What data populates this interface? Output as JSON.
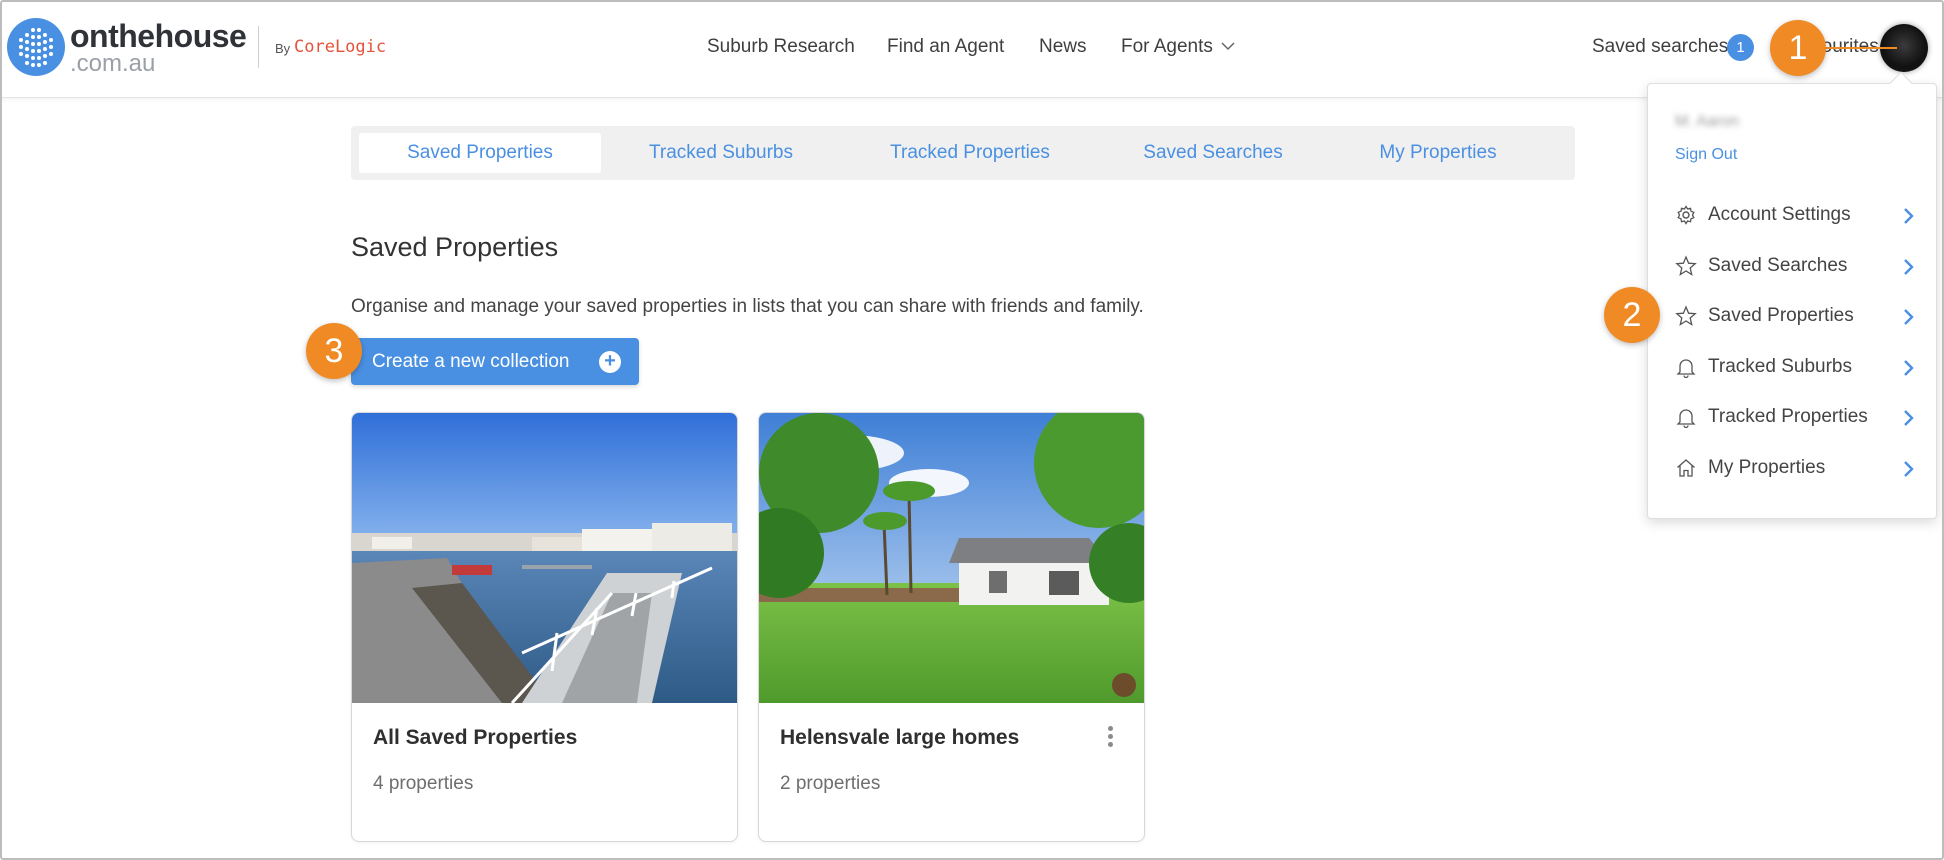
{
  "header": {
    "logo_main": "onthehouse",
    "logo_sub": ".com.au",
    "by_label": "By",
    "partner": "CoreLogic",
    "nav": [
      "Suburb Research",
      "Find an Agent",
      "News",
      "For Agents"
    ],
    "saved_searches_label": "Saved searches",
    "saved_searches_count": "1",
    "favourites_label": "Favourites"
  },
  "steps": [
    "1",
    "2",
    "3"
  ],
  "tabs": [
    "Saved Properties",
    "Tracked Suburbs",
    "Tracked Properties",
    "Saved Searches",
    "My Properties"
  ],
  "active_tab": "Saved Properties",
  "main": {
    "title": "Saved Properties",
    "description": "Organise and manage your saved properties in lists that you can share with friends and family.",
    "create_button": "Create a new collection"
  },
  "collections": [
    {
      "title": "All Saved Properties",
      "count": "4 properties",
      "image": "waterfront-canal-photo"
    },
    {
      "title": "Helensvale large homes",
      "count": "2 properties",
      "image": "house-garden-photo"
    }
  ],
  "user_menu": {
    "user_name": "M. Aaron",
    "sign_out": "Sign Out",
    "items": [
      {
        "label": "Account Settings",
        "icon": "gear-icon"
      },
      {
        "label": "Saved Searches",
        "icon": "star-icon"
      },
      {
        "label": "Saved Properties",
        "icon": "star-icon"
      },
      {
        "label": "Tracked Suburbs",
        "icon": "bell-icon"
      },
      {
        "label": "Tracked Properties",
        "icon": "bell-icon"
      },
      {
        "label": "My Properties",
        "icon": "home-icon"
      }
    ]
  },
  "colors": {
    "brand_blue": "#4a90e2",
    "callout_orange": "#f08a24",
    "corelogic_red": "#e5533b"
  }
}
